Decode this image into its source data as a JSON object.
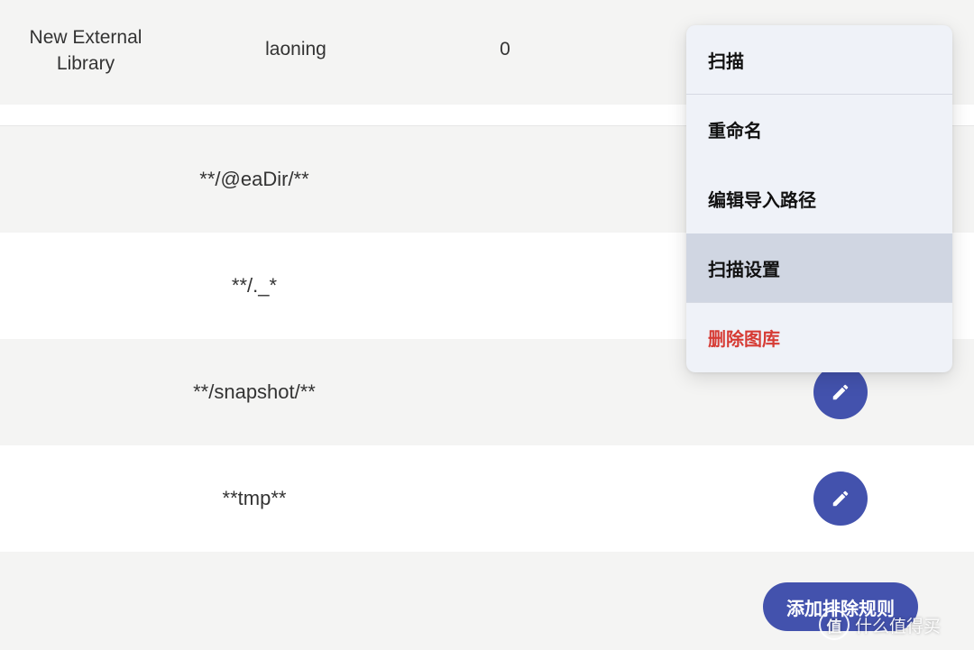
{
  "library": {
    "name": "New External Library",
    "owner": "laoning",
    "asset_count": "0"
  },
  "exclusion_rules": [
    "**/@eaDir/**",
    "**/._*",
    "**/snapshot/**",
    "**tmp**"
  ],
  "context_menu": {
    "items": [
      "扫描",
      "重命名",
      "编辑导入路径",
      "扫描设置",
      "删除图库"
    ],
    "active_item": "扫描设置",
    "danger_color": "#d63b34"
  },
  "add_rule_button": "添加排除规则",
  "watermark": {
    "logo_char": "值",
    "text": "什么值得买"
  },
  "colors": {
    "accent": "#4352ad",
    "row_grey": "#f4f4f3",
    "menu_bg": "#eff2f8",
    "menu_active": "#d0d6e2"
  },
  "icons": {
    "edit": "pencil-icon"
  }
}
